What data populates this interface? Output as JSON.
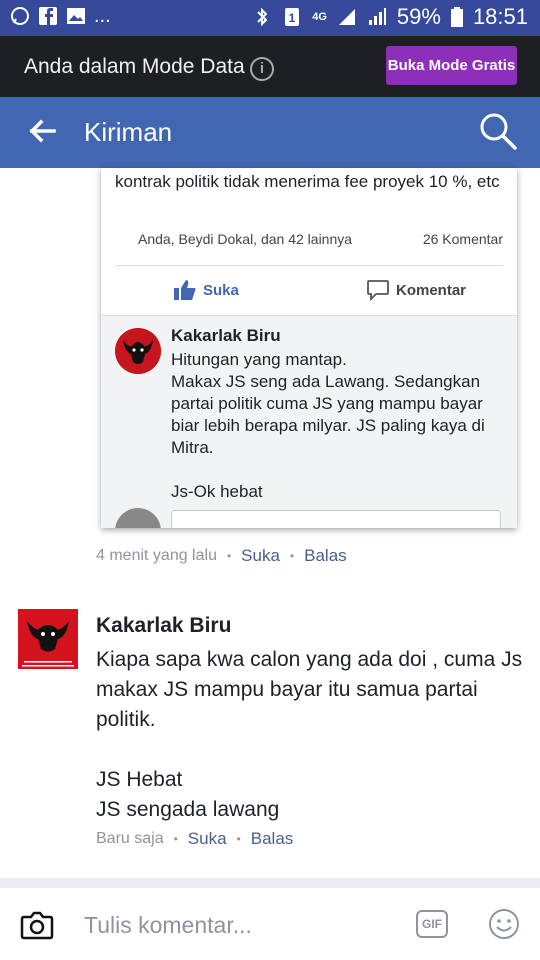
{
  "status_bar": {
    "battery": "59%",
    "time": "18:51",
    "network": "4G",
    "more": "..."
  },
  "data_mode": {
    "message": "Anda dalam Mode Data",
    "free_button": "Buka Mode Gratis"
  },
  "header": {
    "title": "Kiriman"
  },
  "shared_screenshot": {
    "post_text": "kontrak politik tidak menerima fee proyek 10 %, etc",
    "reactors": "Anda, Beydi Dokal, dan 42 lainnya",
    "comment_count": "26 Komentar",
    "like_label": "Suka",
    "comment_label": "Komentar",
    "comment": {
      "name": "Kakarlak Biru",
      "text": "Hitungan yang mantap.\nMakax JS seng ada Lawang. Sedangkan partai politik cuma JS yang mampu bayar biar lebih berapa milyar. JS paling kaya di Mitra.\n\nJs-Ok hebat"
    }
  },
  "first_comment_meta": {
    "time": "4 menit yang lalu",
    "like": "Suka",
    "reply": "Balas"
  },
  "second_comment": {
    "name": "Kakarlak Biru",
    "text": "Kiapa sapa kwa calon yang ada doi , cuma Js makax JS mampu bayar itu samua partai politik.\n\nJS Hebat\nJS sengada lawang",
    "time": "Baru saja",
    "like": "Suka",
    "reply": "Balas"
  },
  "composer": {
    "placeholder": "Tulis komentar...",
    "gif": "GIF"
  },
  "colors": {
    "status_bar": "#37499b",
    "header": "#4267b2",
    "data_bar": "#1d1f23",
    "free_button": "#8e2fb9"
  }
}
